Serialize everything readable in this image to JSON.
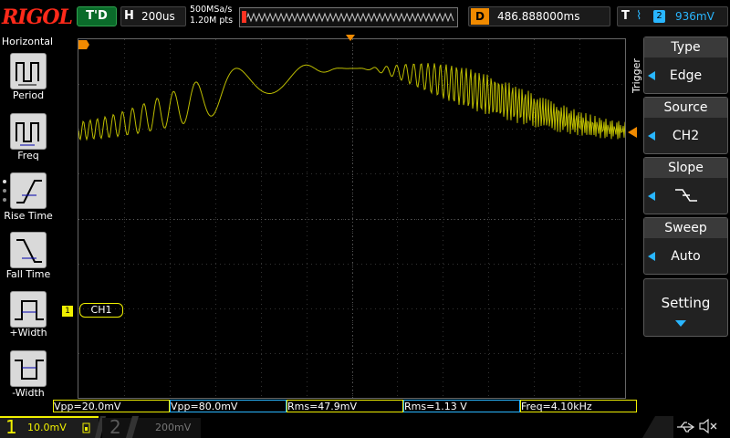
{
  "logo": "RIGOL",
  "status": "T'D",
  "horizontal": {
    "letter": "H",
    "timebase": "200us",
    "sample_rate": "500MSa/s",
    "mem_depth": "1.20M pts"
  },
  "delay": {
    "letter": "D",
    "value": "486.888000ms"
  },
  "trigger_info": {
    "letter": "T",
    "slope_symbol": "⌇",
    "source": "2",
    "level": "936mV"
  },
  "left_menu": {
    "title": "Horizontal",
    "items": [
      {
        "label": "Period",
        "icon": "period-icon"
      },
      {
        "label": "Freq",
        "icon": "freq-icon"
      },
      {
        "label": "Rise Time",
        "icon": "rise-time-icon"
      },
      {
        "label": "Fall Time",
        "icon": "fall-time-icon"
      },
      {
        "label": "+Width",
        "icon": "pos-width-icon"
      },
      {
        "label": "-Width",
        "icon": "neg-width-icon"
      }
    ]
  },
  "right_menu": {
    "trigger_label": "Trigger",
    "items": [
      {
        "heading": "Type",
        "value": "Edge"
      },
      {
        "heading": "Source",
        "value": "CH2"
      },
      {
        "heading": "Slope",
        "value": ""
      },
      {
        "heading": "Sweep",
        "value": "Auto"
      },
      {
        "heading": "Setting",
        "value": ""
      }
    ]
  },
  "ch1_marker": "CH1",
  "channel_marker_1": "1",
  "trigger_marker": "T",
  "measurements": [
    "Vpp=20.0mV",
    "Vpp=80.0mV",
    "Rms=47.9mV",
    "Rms=1.13 V",
    "Freq=4.10kHz"
  ],
  "bottom": {
    "ch1_num": "1",
    "ch1_scale": "10.0mV",
    "ch2_num": "2",
    "ch2_scale": "200mV"
  },
  "colors": {
    "ch1": "#f0f000",
    "ch2": "#29b6ff",
    "trigger": "#f08a00",
    "status": "#0a6b2a",
    "logo": "#ff2a1a"
  }
}
